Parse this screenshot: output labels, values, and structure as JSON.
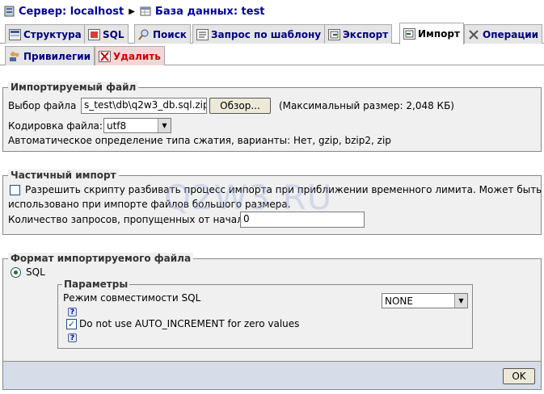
{
  "breadcrumb": {
    "server_label": "Сервер: localhost",
    "db_label": "База данных: test",
    "separator": "▶"
  },
  "tabs": [
    {
      "label": "Структура"
    },
    {
      "label": "SQL"
    },
    {
      "label": "Поиск"
    },
    {
      "label": "Запрос по шаблону"
    },
    {
      "label": "Экспорт"
    },
    {
      "label": "Импорт"
    },
    {
      "label": "Операции"
    },
    {
      "label": "Привилегии"
    },
    {
      "label": "Удалить"
    }
  ],
  "file_section": {
    "legend": "Импортируемый файл",
    "choose_label": "Выбор файла",
    "file_value": "s_test\\db\\q2w3_db.sql.zip",
    "browse_label": "Обзор...",
    "max_size": "(Максимальный размер: 2,048 КБ)",
    "encoding_label": "Кодировка файла:",
    "encoding_value": "utf8",
    "compression_note": "Автоматическое определение типа сжатия, варианты: Нет, gzip, bzip2, zip"
  },
  "partial_section": {
    "legend": "Частичный импорт",
    "allow_line1": "Разрешить скрипту разбивать процесс импорта при приближении временного лимита. Может быть",
    "allow_line2": "использовано при импорте файлов большого размера.",
    "skip_label": "Количество запросов, пропущенных от начала",
    "skip_value": "0"
  },
  "format_section": {
    "legend": "Формат импортируемого файла",
    "format_option": "SQL",
    "params_legend": "Параметры",
    "compat_label": "Режим совместимости SQL",
    "compat_value": "NONE",
    "auto_inc_label": "Do not use AUTO_INCREMENT for zero values",
    "help_glyph": "?"
  },
  "watermark": "Q2W3.RU",
  "footer": {
    "ok_label": "OK"
  }
}
